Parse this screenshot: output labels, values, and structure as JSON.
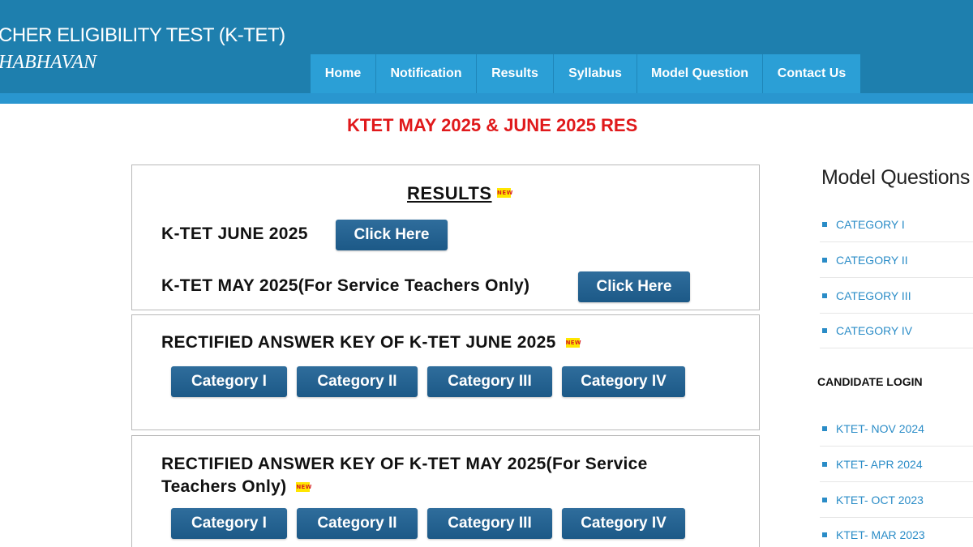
{
  "header": {
    "title": "CHER ELIGIBILITY TEST (K-TET)",
    "subtitle": "HABHAVAN"
  },
  "nav": [
    {
      "label": "Home"
    },
    {
      "label": "Notification"
    },
    {
      "label": "Results"
    },
    {
      "label": "Syllabus"
    },
    {
      "label": "Model Question"
    },
    {
      "label": "Contact Us"
    }
  ],
  "marquee": "KTET MAY 2025 & JUNE 2025 RES",
  "new_badge": "NEW",
  "results": {
    "title": "RESULTS",
    "rows": [
      {
        "label": "K-TET JUNE 2025",
        "button": "Click Here"
      },
      {
        "label": "K-TET MAY 2025(For Service Teachers Only)",
        "button": "Click Here"
      }
    ]
  },
  "answer_key_june": {
    "title": "RECTIFIED ANSWER KEY OF K-TET JUNE 2025",
    "buttons": [
      "Category I",
      "Category II",
      "Category III",
      "Category IV"
    ]
  },
  "answer_key_may": {
    "title": "RECTIFIED ANSWER KEY OF K-TET MAY 2025(For Service Teachers Only)",
    "buttons": [
      "Category I",
      "Category II",
      "Category III",
      "Category IV"
    ]
  },
  "sidebar": {
    "model_questions": {
      "heading": "Model Questions",
      "items": [
        "CATEGORY I",
        "CATEGORY II",
        "CATEGORY III",
        "CATEGORY IV"
      ]
    },
    "candidate_login": {
      "heading": "CANDIDATE LOGIN",
      "items": [
        "KTET- NOV 2024",
        "KTET- APR 2024",
        "KTET- OCT 2023",
        "KTET- MAR 2023"
      ]
    }
  },
  "colors": {
    "header": "#1e7fae",
    "nav": "#2b9fd6",
    "button": "#1c5987",
    "marquee": "#e0191b",
    "link": "#2a8cc7"
  }
}
